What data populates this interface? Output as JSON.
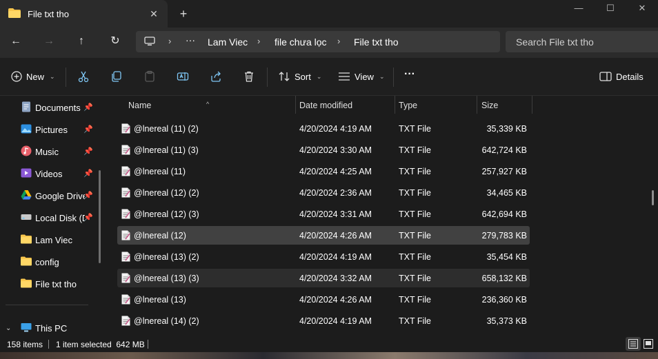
{
  "tab": {
    "title": "File txt tho",
    "close": "✕",
    "new": "+"
  },
  "window": {
    "minimize": "—",
    "maximize": "☐",
    "close": "✕"
  },
  "nav": {
    "back": "←",
    "forward": "→",
    "up": "↑",
    "refresh": "↻"
  },
  "address": {
    "more": "···",
    "crumbs": [
      "Lam Viec",
      "file chưa lọc",
      "File txt tho"
    ],
    "sep": "›"
  },
  "search": {
    "placeholder": "Search File txt tho"
  },
  "commands": {
    "new_label": "New",
    "sort_label": "Sort",
    "view_label": "View",
    "more": "···",
    "details_label": "Details",
    "caret": "⌄"
  },
  "sidebar": {
    "items": [
      {
        "label": "Documents",
        "icon": "documents-icon",
        "pinned": true
      },
      {
        "label": "Pictures",
        "icon": "pictures-icon",
        "pinned": true
      },
      {
        "label": "Music",
        "icon": "music-icon",
        "pinned": true
      },
      {
        "label": "Videos",
        "icon": "videos-icon",
        "pinned": true
      },
      {
        "label": "Google Drive",
        "icon": "google-drive-icon",
        "pinned": true
      },
      {
        "label": "Local Disk (D",
        "icon": "local-disk-icon",
        "pinned": true
      },
      {
        "label": "Lam Viec",
        "icon": "folder-icon",
        "pinned": false
      },
      {
        "label": "config",
        "icon": "folder-icon",
        "pinned": false
      },
      {
        "label": "File txt tho",
        "icon": "folder-icon",
        "pinned": false
      }
    ],
    "this_pc": "This PC",
    "pin": "📌"
  },
  "columns": {
    "name": "Name",
    "date": "Date modified",
    "type": "Type",
    "size": "Size"
  },
  "files": [
    {
      "name": "@lnereal (11) (2)",
      "date": "4/20/2024 4:19 AM",
      "type": "TXT File",
      "size": "35,339 KB",
      "state": ""
    },
    {
      "name": "@lnereal (11) (3)",
      "date": "4/20/2024 3:30 AM",
      "type": "TXT File",
      "size": "642,724 KB",
      "state": ""
    },
    {
      "name": "@lnereal (11)",
      "date": "4/20/2024 4:25 AM",
      "type": "TXT File",
      "size": "257,927 KB",
      "state": ""
    },
    {
      "name": "@lnereal (12) (2)",
      "date": "4/20/2024 2:36 AM",
      "type": "TXT File",
      "size": "34,465 KB",
      "state": ""
    },
    {
      "name": "@lnereal (12) (3)",
      "date": "4/20/2024 3:31 AM",
      "type": "TXT File",
      "size": "642,694 KB",
      "state": ""
    },
    {
      "name": "@lnereal (12)",
      "date": "4/20/2024 4:26 AM",
      "type": "TXT File",
      "size": "279,783 KB",
      "state": "selected"
    },
    {
      "name": "@lnereal (13) (2)",
      "date": "4/20/2024 4:19 AM",
      "type": "TXT File",
      "size": "35,454 KB",
      "state": ""
    },
    {
      "name": "@lnereal (13) (3)",
      "date": "4/20/2024 3:32 AM",
      "type": "TXT File",
      "size": "658,132 KB",
      "state": "hover"
    },
    {
      "name": "@lnereal (13)",
      "date": "4/20/2024 4:26 AM",
      "type": "TXT File",
      "size": "236,360 KB",
      "state": ""
    },
    {
      "name": "@lnereal (14) (2)",
      "date": "4/20/2024 4:19 AM",
      "type": "TXT File",
      "size": "35,373 KB",
      "state": ""
    }
  ],
  "status": {
    "count": "158 items",
    "selection": "1 item selected  642 MB"
  },
  "colors": {
    "accent": "#4cc2ff",
    "folder": "#f8c64d",
    "selected_row": "#414141"
  }
}
